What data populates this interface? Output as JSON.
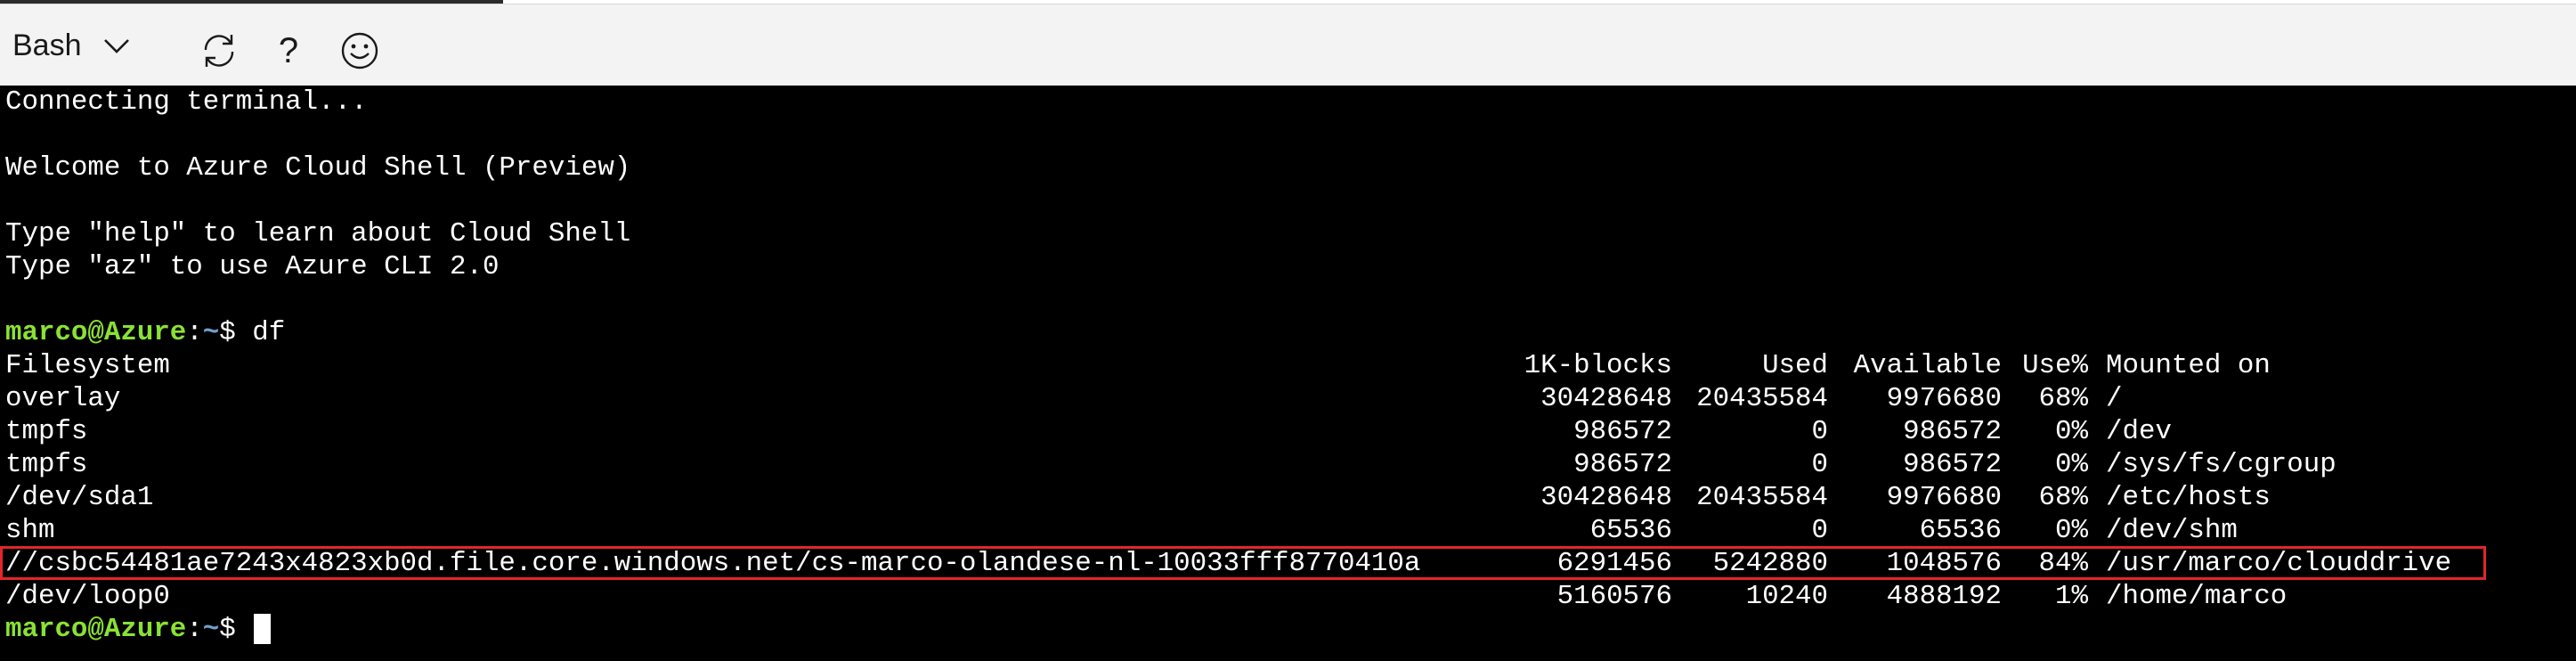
{
  "toolbar": {
    "shell_type": "Bash",
    "shell_dropdown_icon": "chevron-down-icon",
    "restart_icon": "restart-icon",
    "help_label": "?",
    "help_icon": "help-icon",
    "feedback_icon": "smiley-icon"
  },
  "terminal": {
    "intro_lines": [
      "Connecting terminal...",
      "Welcome to Azure Cloud Shell (Preview)",
      "Type \"help\" to learn about Cloud Shell",
      "Type \"az\" to use Azure CLI 2.0"
    ],
    "prompt": {
      "user": "marco@Azure",
      "sep": ":",
      "path": "~",
      "dollar": "$ "
    },
    "command": "df",
    "df_header": [
      "Filesystem",
      "1K-blocks",
      "Used",
      "Available",
      "Use%",
      "Mounted on"
    ],
    "df_rows": [
      [
        "overlay",
        "30428648",
        "20435584",
        "9976680",
        "68%",
        "/"
      ],
      [
        "tmpfs",
        "986572",
        "0",
        "986572",
        "0%",
        "/dev"
      ],
      [
        "tmpfs",
        "986572",
        "0",
        "986572",
        "0%",
        "/sys/fs/cgroup"
      ],
      [
        "/dev/sda1",
        "30428648",
        "20435584",
        "9976680",
        "68%",
        "/etc/hosts"
      ],
      [
        "shm",
        "65536",
        "0",
        "65536",
        "0%",
        "/dev/shm"
      ],
      [
        "//csbc54481ae7243x4823xb0d.file.core.windows.net/cs-marco-olandese-nl-10033fff8770410a",
        "6291456",
        "5242880",
        "1048576",
        "84%",
        "/usr/marco/clouddrive"
      ],
      [
        "/dev/loop0",
        "5160576",
        "10240",
        "4888192",
        "1%",
        "/home/marco"
      ]
    ],
    "highlighted_row_index": 5,
    "colors": {
      "background": "#000000",
      "text": "#ffffff",
      "prompt_user": "#8ae234",
      "prompt_path": "#729fcf",
      "highlight_border": "#e3262b"
    }
  }
}
